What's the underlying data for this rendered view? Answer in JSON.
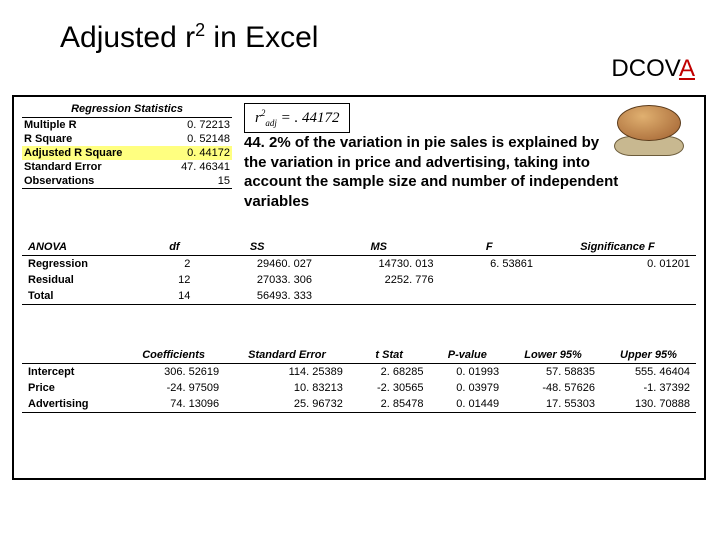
{
  "title_prefix": "Adjusted r",
  "title_sup": "2",
  "title_suffix": " in Excel",
  "dcova_prefix": "DCOV",
  "dcova_a": "A",
  "reg_stats": {
    "header": "Regression Statistics",
    "rows": [
      {
        "label": "Multiple R",
        "value": "0. 72213"
      },
      {
        "label": "R Square",
        "value": "0. 52148"
      },
      {
        "label": "Adjusted R Square",
        "value": "0. 44172"
      },
      {
        "label": "Standard Error",
        "value": "47. 46341"
      },
      {
        "label": "Observations",
        "value": "15"
      }
    ]
  },
  "formula": {
    "r": "r",
    "sup": "2",
    "sub": "adj",
    "eq": " = . 44172"
  },
  "explain": "44. 2% of the variation in pie sales is explained by the variation in price and advertising, taking into account the sample size and number of independent variables",
  "anova": {
    "headers": [
      "ANOVA",
      "df",
      "SS",
      "MS",
      "F",
      "Significance F"
    ],
    "rows": [
      [
        "Regression",
        "2",
        "29460. 027",
        "14730. 013",
        "6. 53861",
        "0. 01201"
      ],
      [
        "Residual",
        "12",
        "27033. 306",
        "2252. 776",
        "",
        ""
      ],
      [
        "Total",
        "14",
        "56493. 333",
        "",
        "",
        ""
      ]
    ]
  },
  "coef": {
    "headers": [
      "",
      "Coefficients",
      "Standard Error",
      "t Stat",
      "P-value",
      "Lower 95%",
      "Upper 95%"
    ],
    "rows": [
      [
        "Intercept",
        "306. 52619",
        "114. 25389",
        "2. 68285",
        "0. 01993",
        "57. 58835",
        "555. 46404"
      ],
      [
        "Price",
        "-24. 97509",
        "10. 83213",
        "-2. 30565",
        "0. 03979",
        "-48. 57626",
        "-1. 37392"
      ],
      [
        "Advertising",
        "74. 13096",
        "25. 96732",
        "2. 85478",
        "0. 01449",
        "17. 55303",
        "130. 70888"
      ]
    ]
  }
}
